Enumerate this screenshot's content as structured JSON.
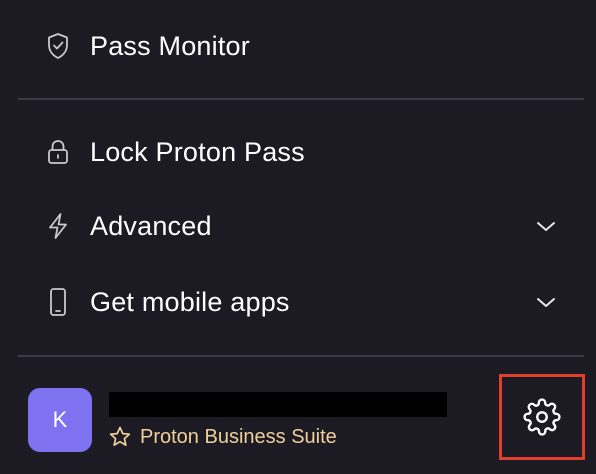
{
  "menu": {
    "pass_monitor": {
      "label": "Pass Monitor",
      "icon": "shield-check-icon"
    },
    "lock": {
      "label": "Lock Proton Pass",
      "icon": "lock-icon"
    },
    "advanced": {
      "label": "Advanced",
      "icon": "lightning-icon",
      "expand_icon": "chevron-down-icon"
    },
    "mobile": {
      "label": "Get mobile apps",
      "icon": "mobile-phone-icon",
      "expand_icon": "chevron-down-icon"
    }
  },
  "account": {
    "avatar_initial": "K",
    "name_redacted": true,
    "plan": "Proton Business Suite",
    "plan_icon": "star-icon",
    "settings_icon": "gear-icon"
  },
  "colors": {
    "background": "#1c1b24",
    "divider": "#3b3a45",
    "avatar": "#7f72f0",
    "plan_text": "#f0d09a",
    "highlight": "#e0402b"
  }
}
